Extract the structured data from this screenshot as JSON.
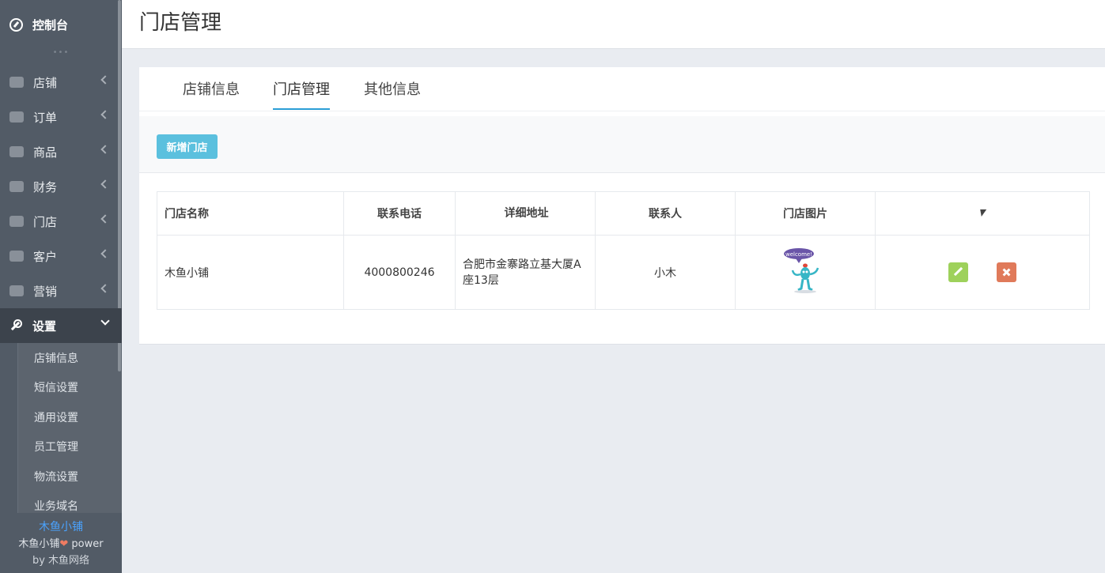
{
  "sidebar": {
    "dashboard": "控制台",
    "items": [
      {
        "label": "店铺",
        "icon": "basket-icon"
      },
      {
        "label": "订单",
        "icon": "money-icon"
      },
      {
        "label": "商品",
        "icon": "balance-scale-icon"
      },
      {
        "label": "财务",
        "icon": "cash-icon"
      },
      {
        "label": "门店",
        "icon": "sitemap-icon"
      },
      {
        "label": "客户",
        "icon": "users-icon"
      },
      {
        "label": "营销",
        "icon": "gift-icon"
      },
      {
        "label": "设置",
        "icon": "wrench-icon"
      }
    ],
    "submenu": [
      "店铺信息",
      "短信设置",
      "通用设置",
      "员工管理",
      "物流设置",
      "业务域名"
    ],
    "footer": {
      "brand": "木鱼小铺",
      "power_prefix": "木鱼小铺",
      "heart": "❤",
      "power_suffix": " power",
      "by": "by 木鱼网络"
    }
  },
  "header": {
    "title": "门店管理"
  },
  "tabs": [
    "店铺信息",
    "门店管理",
    "其他信息"
  ],
  "toolbar": {
    "add_label": "新增门店"
  },
  "table": {
    "headers": [
      "门店名称",
      "联系电话",
      "详细地址",
      "联系人",
      "门店图片",
      ""
    ],
    "rows": [
      {
        "name": "木鱼小铺",
        "phone": "4000800246",
        "address": "合肥市金寨路立基大厦A座13层",
        "contact": "小木",
        "image_text": "welcome!"
      }
    ]
  },
  "colors": {
    "sidebar": "#525b66",
    "accent": "#2b9ed6",
    "add_button": "#5bc0de",
    "edit": "#9ed15b",
    "delete": "#e07a5a"
  }
}
